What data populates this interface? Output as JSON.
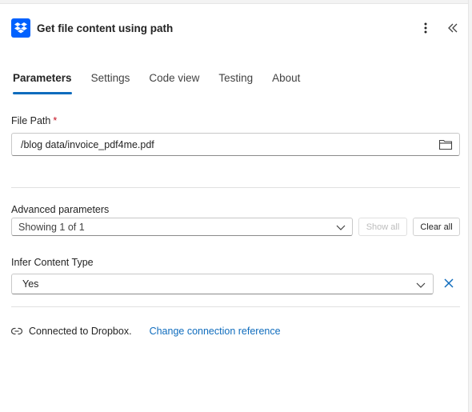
{
  "header": {
    "title": "Get file content using path"
  },
  "tabs": [
    {
      "label": "Parameters",
      "active": true
    },
    {
      "label": "Settings"
    },
    {
      "label": "Code view"
    },
    {
      "label": "Testing"
    },
    {
      "label": "About"
    }
  ],
  "file_path": {
    "label": "File Path",
    "required_marker": "*",
    "value": "/blog data/invoice_pdf4me.pdf"
  },
  "advanced": {
    "label": "Advanced parameters",
    "selected": "Showing 1 of 1",
    "show_all": "Show all",
    "clear_all": "Clear all"
  },
  "infer": {
    "label": "Infer Content Type",
    "value": "Yes"
  },
  "connection": {
    "status": "Connected to Dropbox.",
    "change_link": "Change connection reference"
  },
  "colors": {
    "accent": "#0f6cbd",
    "brand": "#0061fe",
    "required": "#c50f1f"
  },
  "icons": [
    "dropbox-icon",
    "more-vertical-icon",
    "collapse-double-chevron-icon",
    "folder-icon",
    "chevron-down-icon",
    "close-icon",
    "link-icon"
  ]
}
